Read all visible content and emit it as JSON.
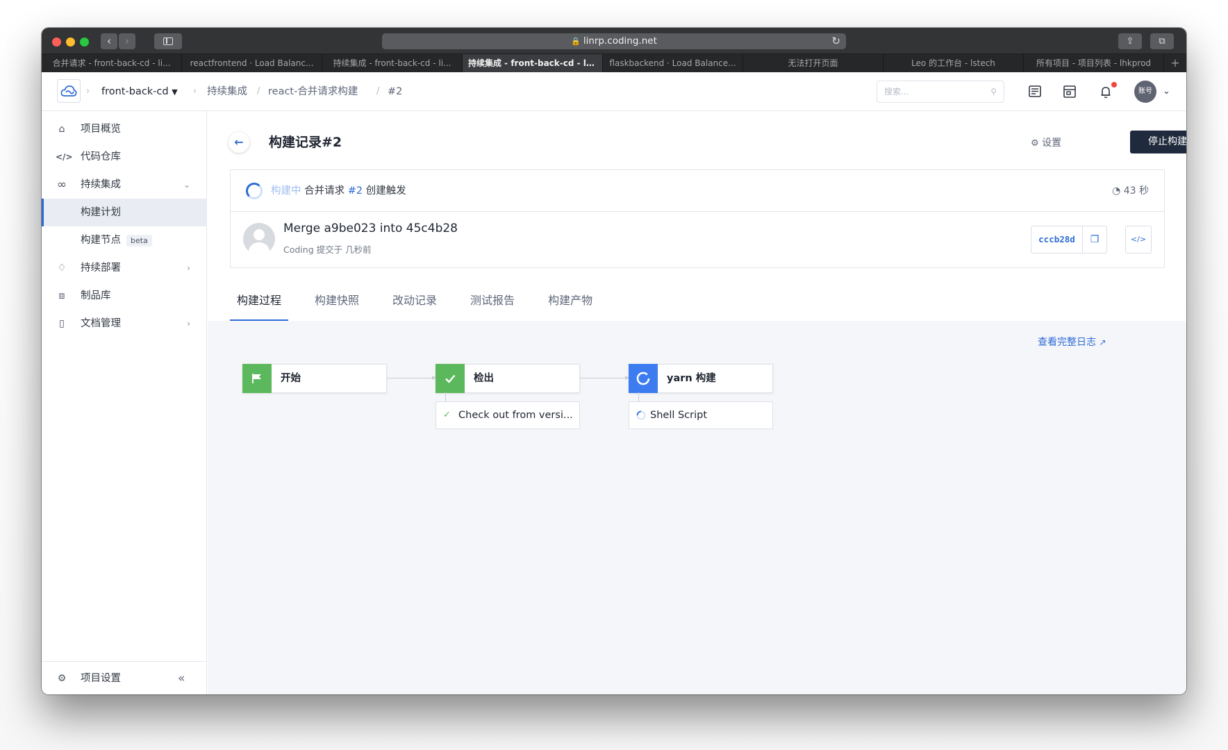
{
  "browser": {
    "url": "linrp.coding.net",
    "tabs": [
      "合并请求 - front-back-cd - li...",
      "reactfrontend · Load Balanc...",
      "持续集成 - front-back-cd - li...",
      "持续集成 - front-back-cd - li...",
      "flaskbackend · Load Balance...",
      "无法打开页面",
      "Leo 的工作台 - lstech",
      "所有项目 - 项目列表 - lhkprod"
    ],
    "active_tab_index": 3
  },
  "header": {
    "project": "front-back-cd",
    "crumbs": [
      "持续集成",
      "react-合并请求构建",
      "#2"
    ],
    "search_placeholder": "搜索...",
    "avatar_label": "账号",
    "notification_dot_color": "#f2453d"
  },
  "sidebar": {
    "items": [
      {
        "label": "项目概览",
        "icon": "home-icon"
      },
      {
        "label": "代码仓库",
        "icon": "code-icon"
      },
      {
        "label": "持续集成",
        "icon": "infinity-icon"
      },
      {
        "label": "构建计划",
        "icon": ""
      },
      {
        "label": "构建节点",
        "badge": "beta",
        "icon": ""
      },
      {
        "label": "持续部署",
        "icon": "rocket-icon"
      },
      {
        "label": "制品库",
        "icon": "artifact-icon"
      },
      {
        "label": "文档管理",
        "icon": "document-icon"
      }
    ],
    "settings_label": "项目设置",
    "collapse_symbol": "«"
  },
  "main": {
    "title": "构建记录#2",
    "settings_label": "设置",
    "stop_label": "停止构建",
    "status": {
      "state": "构建中",
      "trigger_prefix": "合并请求",
      "pr": "#2",
      "trigger_suffix": "创建触发",
      "elapsed": "43 秒"
    },
    "commit": {
      "message": "Merge a9be023 into 45c4b28",
      "author": "Coding",
      "meta": "提交于 几秒前",
      "sha": "cccb28d"
    },
    "tabs": [
      "构建过程",
      "构建快照",
      "改动记录",
      "测试报告",
      "构建产物"
    ],
    "active_tab": 0,
    "log_link": "查看完整日志",
    "pipeline": {
      "stages": [
        {
          "name": "开始",
          "status": "start",
          "color": "#5cb85c"
        },
        {
          "name": "检出",
          "status": "success",
          "color": "#5cb85c",
          "steps": [
            {
              "label": "Check out from versi...",
              "status": "success"
            }
          ]
        },
        {
          "name": "yarn 构建",
          "status": "running",
          "color": "#3d7cf0",
          "steps": [
            {
              "label": "Shell Script",
              "status": "running"
            }
          ]
        }
      ]
    }
  },
  "colors": {
    "accent": "#2d6bd6",
    "dark_button": "#1f2a3c",
    "success": "#5cb85c",
    "running": "#3d7cf0"
  }
}
